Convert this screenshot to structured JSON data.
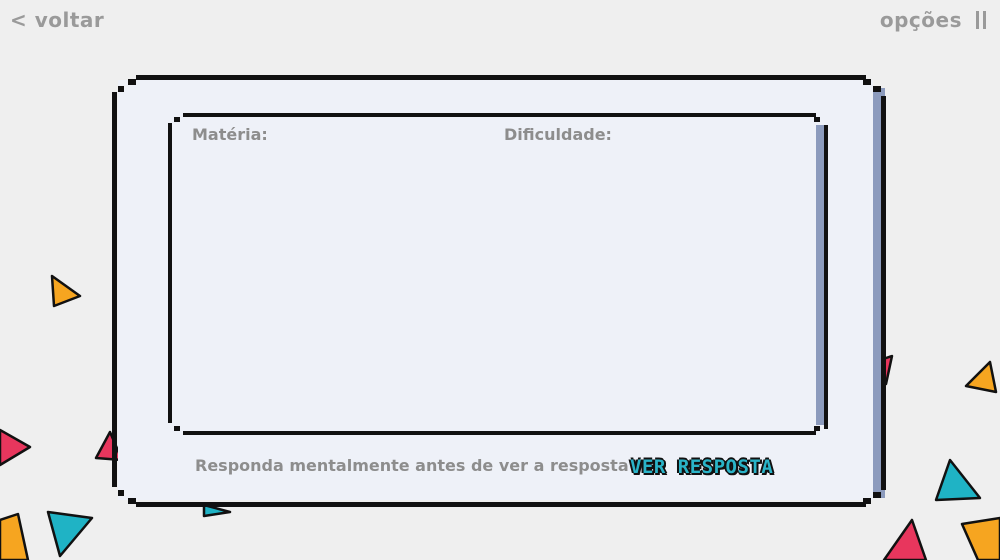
{
  "nav": {
    "back_label": "< voltar",
    "options_label": "opções",
    "options_icon": "pause-icon"
  },
  "card": {
    "subject_label": "Matéria:",
    "difficulty_label": "Dificuldade:",
    "hint": "Responda mentalmente antes de ver a resposta",
    "reveal_button": "VER RESPOSTA"
  },
  "colors": {
    "background": "#efefef",
    "card": "#eef1f8",
    "card_shadow": "#8c9bbd",
    "accent_teal": "#2ab4c8",
    "confetti_orange": "#f6a520",
    "confetti_pink": "#e8365d",
    "confetti_teal": "#1fb3c5",
    "muted_text": "#8d8d8d"
  }
}
